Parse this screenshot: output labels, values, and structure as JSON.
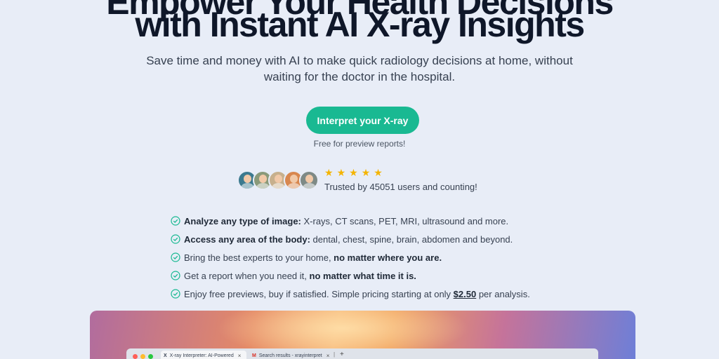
{
  "hero": {
    "headline_top": "Empower Your Health Decisions",
    "headline": "with Instant AI X-ray Insights",
    "subtitle": "Save time and money with AI to make quick radiology decisions at home, without waiting for the doctor in the hospital."
  },
  "cta": {
    "label": "Interpret your X-ray",
    "note": "Free for preview reports!",
    "color": "#19b992"
  },
  "social_proof": {
    "stars": [
      "★",
      "★",
      "★",
      "★",
      "★"
    ],
    "rating_stars": 5,
    "trusted_text": "Trusted by 45051 users and counting!",
    "avatar_colors": [
      "#3c7a8f",
      "#8a9a7a",
      "#c7b08d",
      "#d8874f",
      "#7e8a86"
    ]
  },
  "features": [
    {
      "bold": "Analyze any type of image:",
      "text": " X-rays, CT scans, PET, MRI, ultrasound and more."
    },
    {
      "bold": "Access any area of the body:",
      "text": " dental, chest, spine, brain, abdomen and beyond."
    },
    {
      "text": "Bring the best experts to your home, ",
      "bold_after": "no matter where you are."
    },
    {
      "text": "Get a report when you need it, ",
      "bold_after": "no matter what time it is."
    },
    {
      "text": "Enjoy free previews, buy if satisfied. Simple pricing starting at only ",
      "price": "$2.50",
      "text_after": " per analysis."
    }
  ],
  "browser_preview": {
    "tabs": [
      {
        "icon": "X",
        "title": "X-ray Interpreter: AI-Powered",
        "close": "×"
      },
      {
        "icon": "M",
        "title": "Search results - xrayinterpret",
        "close": "×"
      }
    ],
    "new_tab": "+",
    "divider": "|"
  },
  "colors": {
    "background": "#e8edf7",
    "accent": "#19b992",
    "star": "#f4b400",
    "check": "#19b992"
  }
}
